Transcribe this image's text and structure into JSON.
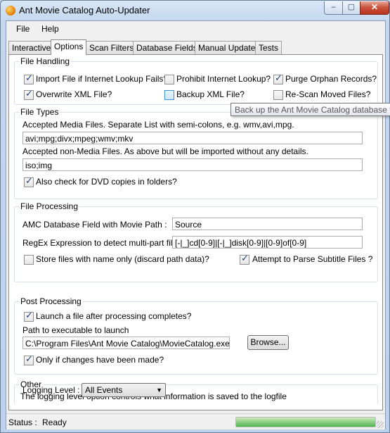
{
  "window": {
    "title": "Ant Movie Catalog Auto-Updater",
    "controls": {
      "minimize": "–",
      "maximize": "▢",
      "close": "✕"
    }
  },
  "menu": [
    "File",
    "Help"
  ],
  "tabs": [
    "Interactive",
    "Options",
    "Scan Filters",
    "Database Fields",
    "Manual Update",
    "Tests"
  ],
  "active_tab": "Options",
  "file_handling": {
    "title": "File Handling",
    "options": {
      "import_if_lookup_fails": {
        "label": "Import File if Internet Lookup Fails?",
        "checked": true
      },
      "prohibit_lookup": {
        "label": "Prohibit Internet Lookup?",
        "checked": false
      },
      "purge_orphans": {
        "label": "Purge Orphan Records?",
        "checked": true
      },
      "overwrite_xml": {
        "label": "Overwrite XML File?",
        "checked": true
      },
      "backup_xml": {
        "label": "Backup XML File?",
        "checked": false
      },
      "rescan_moved": {
        "label": "Re-Scan Moved Files?",
        "checked": false
      }
    }
  },
  "tooltip": "Back up the Ant Movie Catalog database f",
  "file_types": {
    "title": "File Types",
    "media_label": "Accepted Media Files. Separate List with semi-colons, e.g. wmv,avi,mpg.",
    "media_value": "avi;mpg;divx;mpeg;wmv;mkv",
    "nonmedia_label": "Accepted non-Media Files.  As above but will be imported without any details.",
    "nonmedia_value": "iso;img",
    "dvd_check": {
      "label": "Also check for DVD copies in folders?",
      "checked": true
    }
  },
  "file_processing": {
    "title": "File Processing",
    "field_label": "AMC Database Field with Movie Path :",
    "field_value": "Source",
    "regex_label": "RegEx Expression to detect multi-part files :",
    "regex_value": "[-|_]cd[0-9]|[-|_]disk[0-9]|[0-9]of[0-9]",
    "store_name_only": {
      "label": "Store files with name only (discard path data)?",
      "checked": false
    },
    "parse_subtitles": {
      "label": "Attempt to Parse Subtitle Files ?",
      "checked": true
    }
  },
  "post_processing": {
    "title": "Post Processing",
    "launch": {
      "label": "Launch a file after processing completes?",
      "checked": true
    },
    "path_label": "Path to executable to launch",
    "path_value": "C:\\Program Files\\Ant Movie Catalog\\MovieCatalog.exe",
    "browse_label": "Browse...",
    "only_if_changed": {
      "label": "Only if changes have been made?",
      "checked": true
    }
  },
  "other": {
    "title": "Other",
    "description": "The logging level option controls what information is saved to the logfile",
    "logging_label": "Logging Level :",
    "logging_value": "All Events"
  },
  "status": {
    "label": "Status :",
    "value": "Ready",
    "progress": 1.0
  }
}
